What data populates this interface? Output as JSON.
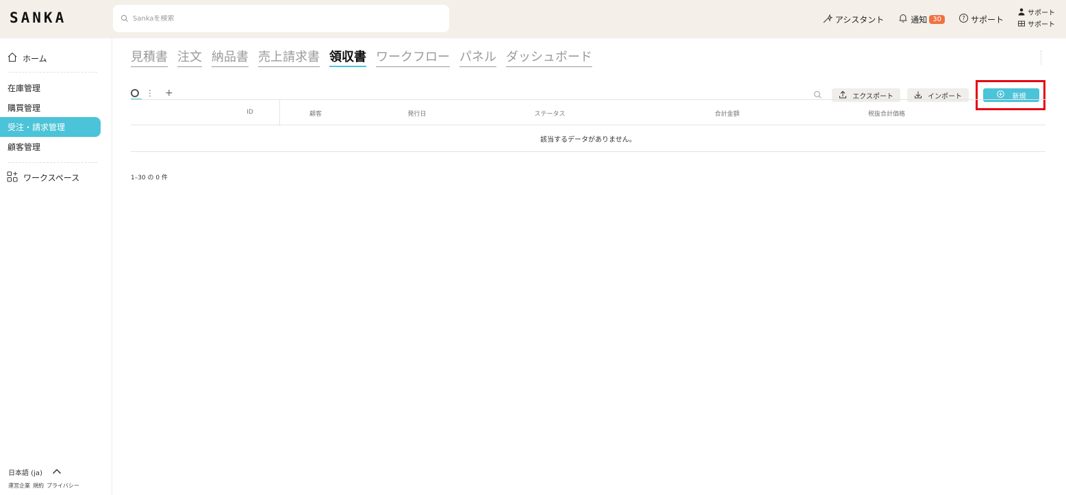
{
  "app": {
    "logo": "SANKA"
  },
  "search": {
    "placeholder": "Sankaを検索"
  },
  "topbar": {
    "assistant_label": "アシスタント",
    "notifications_label": "通知",
    "notifications_count": "30",
    "support_label": "サポート",
    "user_name": "サポート",
    "workspace_name": "サポート"
  },
  "sidebar": {
    "home_label": "ホーム",
    "items": [
      {
        "label": "在庫管理"
      },
      {
        "label": "購買管理"
      },
      {
        "label": "受注・請求管理",
        "active": true
      },
      {
        "label": "顧客管理"
      }
    ],
    "workspace_label": "ワークスペース",
    "language": "日本語 (ja)",
    "footer_links": [
      "運営企業",
      "規約",
      "プライバシー"
    ]
  },
  "tabs": [
    {
      "label": "見積書"
    },
    {
      "label": "注文"
    },
    {
      "label": "納品書"
    },
    {
      "label": "売上請求書"
    },
    {
      "label": "領収書",
      "active": true
    },
    {
      "label": "ワークフロー"
    },
    {
      "label": "パネル"
    },
    {
      "label": "ダッシュボード"
    }
  ],
  "toolbar": {
    "export_label": "エクスポート",
    "import_label": "インポート",
    "new_label": "新規"
  },
  "table": {
    "columns": [
      "ID",
      "顧客",
      "発行日",
      "ステータス",
      "合計金額",
      "税抜合計価格"
    ],
    "empty_message": "該当するデータがありません。"
  },
  "pagination": {
    "summary": "1–30 の 0 件"
  },
  "colors": {
    "accent": "#4bc3d8",
    "badge": "#f07140",
    "highlight_border": "#e60012",
    "topbar_bg": "#f4f0e9"
  }
}
